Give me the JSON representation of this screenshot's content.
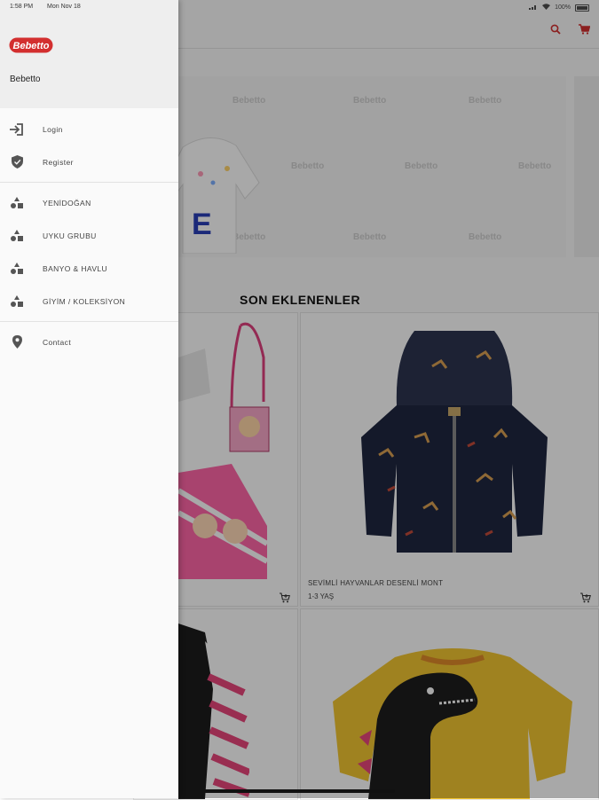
{
  "status_bar": {
    "time": "1:58 PM",
    "date": "Mon Nov 18",
    "battery": "100%"
  },
  "drawer": {
    "brand_logo": "Bebetto",
    "user_name": "Bebetto",
    "account_items": [
      {
        "label": "Login",
        "icon": "login-icon"
      },
      {
        "label": "Register",
        "icon": "shield-check-icon"
      }
    ],
    "category_items": [
      {
        "label": "YENİDOĞAN",
        "icon": "category-icon"
      },
      {
        "label": "UYKU GRUBU",
        "icon": "category-icon"
      },
      {
        "label": "BANYO & HAVLU",
        "icon": "category-icon"
      },
      {
        "label": "GİYİM / KOLEKSİYON",
        "icon": "category-icon"
      }
    ],
    "other_items": [
      {
        "label": "Contact",
        "icon": "location-pin-icon"
      }
    ]
  },
  "app": {
    "banner_watermark": "Bebetto",
    "section_title": "SON EKLENENLER",
    "products": [
      {
        "name": "SEVİMLİ HAYVANLAR DESENLİ MONT",
        "age": "1-3 YAŞ"
      }
    ]
  },
  "colors": {
    "brand_red": "#d32f2f",
    "scrim": "rgba(0,0,0,0.34)"
  }
}
